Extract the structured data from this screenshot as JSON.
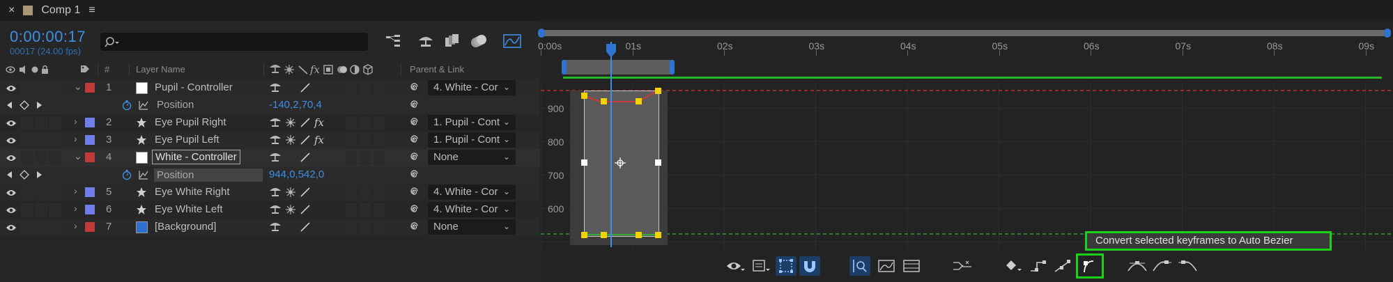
{
  "tab": {
    "close_glyph": "×",
    "title": "Comp 1",
    "menu_glyph": "≡"
  },
  "timeline": {
    "timecode": "0:00:00:17",
    "frame_info": "00017 (24.00 fps)",
    "search_placeholder": "ρ",
    "columns": {
      "hash": "#",
      "layer_name": "Layer Name",
      "parent_link": "Parent & Link"
    }
  },
  "layers": [
    {
      "num": "1",
      "name": "Pupil - Controller",
      "label_color": "#c03a3a",
      "type": "solid",
      "solid_color": "#ffffff",
      "expanded": true,
      "parent": "4. White - Cor",
      "fx": false
    },
    {
      "num": "2",
      "name": "Eye Pupil Right",
      "label_color": "#6f7ee8",
      "type": "shape",
      "expanded": false,
      "parent": "1. Pupil - Cont",
      "fx": true
    },
    {
      "num": "3",
      "name": "Eye Pupil Left",
      "label_color": "#6f7ee8",
      "type": "shape",
      "expanded": false,
      "parent": "1. Pupil - Cont",
      "fx": true
    },
    {
      "num": "4",
      "name": "White - Controller",
      "label_color": "#c03a3a",
      "type": "solid",
      "solid_color": "#ffffff",
      "expanded": true,
      "parent": "None",
      "fx": false
    },
    {
      "num": "5",
      "name": "Eye White Right",
      "label_color": "#6f7ee8",
      "type": "shape",
      "expanded": false,
      "parent": "4. White - Cor",
      "fx": false
    },
    {
      "num": "6",
      "name": "Eye White Left",
      "label_color": "#6f7ee8",
      "type": "shape",
      "expanded": false,
      "parent": "4. White - Cor",
      "fx": false
    },
    {
      "num": "7",
      "name": "[Background]",
      "label_color": "#c03a3a",
      "type": "solid",
      "solid_color": "#2d6fd0",
      "expanded": false,
      "parent": "None",
      "fx": false
    }
  ],
  "properties": {
    "layer1": {
      "name": "Position",
      "value": "-140,2,70,4"
    },
    "layer4": {
      "name": "Position",
      "value": "944,0,542,0"
    }
  },
  "ruler": {
    "labels": [
      "0:00s",
      "01s",
      "02s",
      "03s",
      "04s",
      "05s",
      "06s",
      "07s",
      "08s",
      "09s"
    ]
  },
  "graph": {
    "y_labels": [
      "900",
      "800",
      "700",
      "600"
    ]
  },
  "tooltip": "Convert selected keyframes to Auto Bezier",
  "colors": {
    "accent_blue": "#3d8ee6",
    "highlight_green": "#19d219",
    "work_area_green": "#27b827"
  },
  "bottom_toolbar_icons": [
    "eye-icon",
    "graph-type-icon",
    "transform-box-icon",
    "snap-icon",
    "fit-selection-icon",
    "fit-all-icon",
    "fit-graph-icon",
    "separate-dimensions-icon",
    "edit-keyframe-icon",
    "convert-hold-icon",
    "convert-auto-bezier-icon",
    "convert-linear-icon",
    "easy-ease-icon",
    "easy-ease-in-icon",
    "easy-ease-out-icon"
  ]
}
